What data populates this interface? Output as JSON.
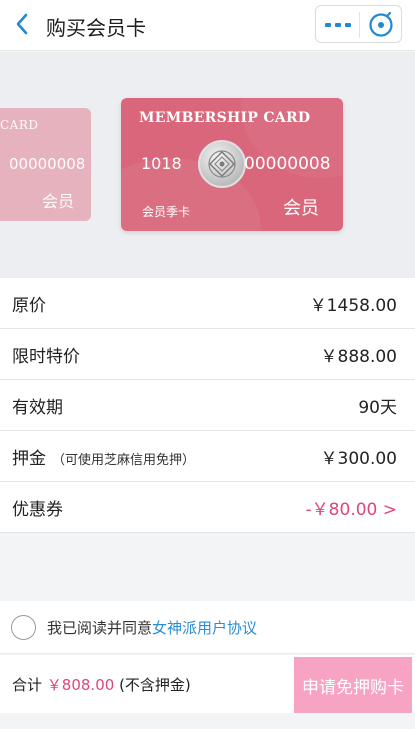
{
  "header": {
    "title": "购买会员卡",
    "back_icon": "chevron-left-icon",
    "more_icon": "more-dots-icon",
    "close_icon": "close-circle-icon",
    "accent": "#1f8ad3"
  },
  "cards": {
    "left": {
      "title": "CARD",
      "number": "00000008",
      "name": "会员"
    },
    "main": {
      "title": "MEMBERSHIP CARD",
      "prefix": "1018",
      "number": "00000008",
      "subtitle": "会员季卡",
      "name": "会员",
      "color": "#d9667b"
    }
  },
  "details": [
    {
      "label": "原价",
      "note": "",
      "value": "￥1458.00"
    },
    {
      "label": "限时特价",
      "note": "",
      "value": "￥888.00"
    },
    {
      "label": "有效期",
      "note": "",
      "value": "90天"
    },
    {
      "label": "押金",
      "note": "（可使用芝麻信用免押）",
      "value": "￥300.00"
    },
    {
      "label": "优惠券",
      "note": "",
      "value": "-￥80.00 >"
    }
  ],
  "agreement": {
    "text": "我已阅读并同意",
    "link": "女神派用户协议"
  },
  "footer": {
    "total_label": "合计",
    "total_price": "￥808.00",
    "total_note": "(不含押金)",
    "buy_button": "申请免押购卡",
    "button_color": "#f7a3c3"
  }
}
